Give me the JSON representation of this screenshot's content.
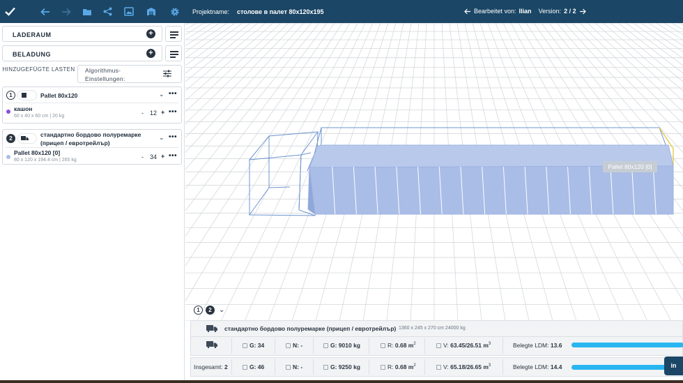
{
  "topbar": {
    "project_label": "Projektname:",
    "project_name": "столове в палет 80x120x195",
    "edited_by_label": "Bearbeitet von:",
    "edited_by_user": "Ilian",
    "version_label": "Version:",
    "version_value": "2 / 2",
    "icons": [
      "check-icon",
      "undo-arrow-icon",
      "redo-arrow-icon",
      "folder-icon",
      "share-icon",
      "gallery-icon",
      "warehouse-icon",
      "settings-gear-icon"
    ]
  },
  "sidebar": {
    "laderaum_label": "LADERAUM",
    "beladung_label": "BELADUNG",
    "tab_added_loads": "HINZUGEFÜGTE LASTEN",
    "tab_algorithm": "Algorithmus-Einstellungen:",
    "groups": [
      {
        "number": "1",
        "title": "Pallet 80x120",
        "items": [
          {
            "name": "кашон",
            "sub": "60 x 40 x 60 cm | 20 kg",
            "qty": "12",
            "color": "#8a4fd6"
          }
        ]
      },
      {
        "number": "2",
        "title_line1": "стандартно бордово полуремарке",
        "title_line2": "(прицеп / евротрейлър)",
        "items": [
          {
            "name": "Pallet 80x120 [0]",
            "sub": "80 x 120 x 194.4 cm | 265 kg",
            "qty": "34",
            "color": "#a9bde6"
          }
        ]
      }
    ],
    "minus": "-",
    "plus": "+",
    "dots": "•••"
  },
  "viewport": {
    "tooltip": "Pallet 80x120 [0]",
    "view_tab_1": "1",
    "view_tab_2": "2",
    "cargo_color": "#a9bde6",
    "wire_color": "#6d95d1",
    "grid_color": "#d4d8dc"
  },
  "panel_vehicle": {
    "title": "стандартно бордово полуремарке (прицеп / евротрейлър)",
    "dims": "1360 x 245 x 270 cm 24000 kg",
    "g_count": "G: 34",
    "n_value": "N: -",
    "weight": "G: 9010 kg",
    "r_label": "R:",
    "r_value": "0.68 m",
    "v_label": "V:",
    "v_value": "63.45/26.51 m",
    "ldm_label": "Belegte LDM:",
    "ldm_value": "13.6",
    "ldm_progress": 1.0
  },
  "panel_total": {
    "label": "Insgesamt:",
    "count": "2",
    "g_count": "G: 46",
    "n_value": "N: -",
    "weight": "G: 9250 kg",
    "r_label": "R:",
    "r_value": "0.68 m",
    "v_label": "V:",
    "v_value": "65.18/26.65 m",
    "ldm_label": "Belegte LDM:",
    "ldm_value": "14.4",
    "ldm_progress": 1.0
  },
  "linkedin_label": "in",
  "accent_color": "#29b6f0",
  "header_color": "#1b4666"
}
